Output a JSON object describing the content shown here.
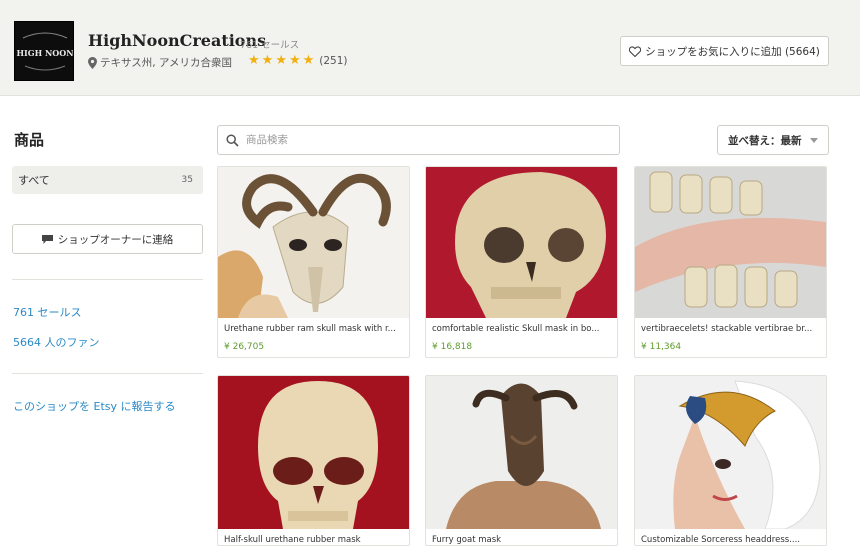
{
  "header": {
    "logo_text": "HIGH NOON",
    "shop_name": "HighNoonCreations",
    "sales": "761 セールス",
    "location": "テキサス州, アメリカ合衆国",
    "rating": 5,
    "review_count": "(251)",
    "favorite_button": "ショップをお気に入りに追加 (5664)"
  },
  "sidebar": {
    "title": "商品",
    "category_all": {
      "label": "すべて",
      "count": "35"
    },
    "contact_button": "ショップオーナーに連絡",
    "sales_link": "761 セールス",
    "fans_link": "5664 人のファン",
    "report_link": "このショップを Etsy に報告する"
  },
  "toolbar": {
    "search_placeholder": "商品検索",
    "sort_label": "並べ替え：最新"
  },
  "listings": [
    {
      "title": "Urethane rubber ram skull mask with r...",
      "price": "¥ 26,705"
    },
    {
      "title": "comfortable realistic Skull mask in bo...",
      "price": "¥ 16,818"
    },
    {
      "title": "vertibraecelets! stackable vertibrae br...",
      "price": "¥ 11,364"
    },
    {
      "title": "Half-skull urethane rubber mask",
      "price": ""
    },
    {
      "title": "Furry goat mask",
      "price": ""
    },
    {
      "title": "Customizable Sorceress headdress....",
      "price": ""
    }
  ],
  "colors": {
    "header_bg": "#f2f2ef",
    "link": "#2a8ac6",
    "price": "#5e9c2c",
    "star": "#f1b00f"
  },
  "icons": [
    "pin-icon",
    "star-icon",
    "heart-icon",
    "message-icon",
    "search-icon",
    "chevron-down-icon"
  ]
}
